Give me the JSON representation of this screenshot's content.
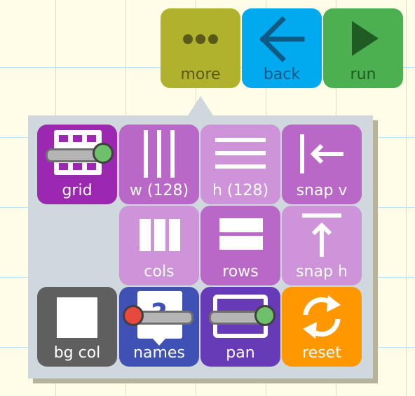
{
  "toolbar": {
    "more_label": "more",
    "back_label": "back",
    "run_label": "run"
  },
  "menu": {
    "grid_label": "grid",
    "grid_toggle": "on",
    "w_label": "w (128)",
    "h_label": "h (128)",
    "snap_v_label": "snap v",
    "cols_label": "cols",
    "rows_label": "rows",
    "snap_h_label": "snap h",
    "bg_col_label": "bg col",
    "names_label": "names",
    "names_toggle": "off",
    "pan_label": "pan",
    "pan_toggle": "on",
    "reset_label": "reset"
  },
  "colors": {
    "more": "#b0b22e",
    "back": "#01a9ee",
    "run": "#4caf50",
    "grid": "#9c27b0",
    "w": "#ba68c8",
    "h": "#ce93d8",
    "snap_v": "#ba68c8",
    "cols": "#ce93d8",
    "rows": "#ba68c8",
    "snap_h": "#ce93d8",
    "bg_col": "#5f5f5f",
    "names": "#3f51b5",
    "pan": "#673ab7",
    "reset": "#ff9800",
    "toggle_on": "#6fc06a",
    "toggle_off": "#e8493d"
  }
}
